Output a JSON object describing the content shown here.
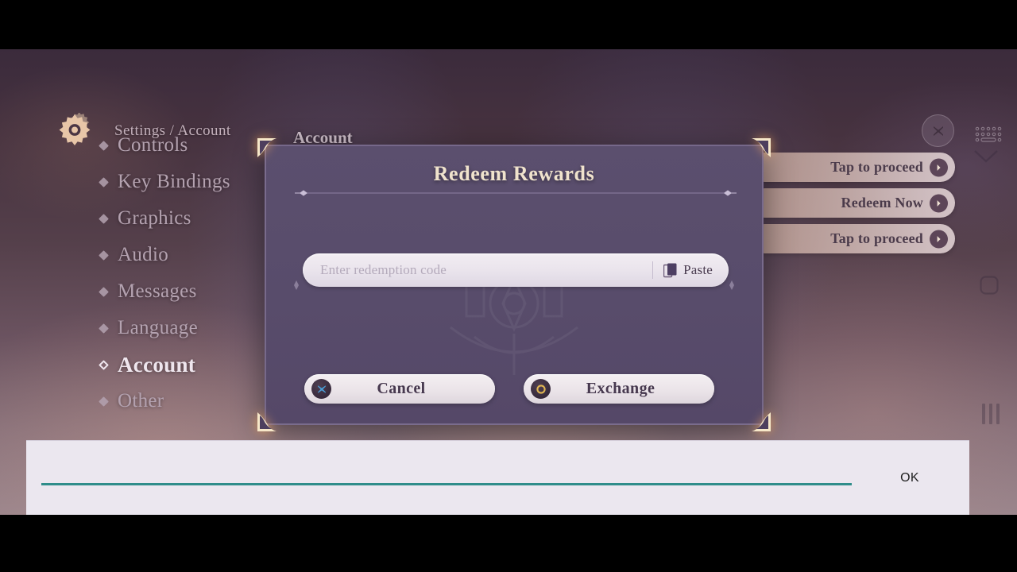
{
  "header": {
    "breadcrumb": "Settings / Account",
    "gear_icon": "gear-icon",
    "close_icon": "close-icon",
    "keyboard_icon": "keyboard-icon"
  },
  "sidebar": {
    "items": [
      {
        "label": "Controls",
        "active": false
      },
      {
        "label": "Key Bindings",
        "active": false
      },
      {
        "label": "Graphics",
        "active": false
      },
      {
        "label": "Audio",
        "active": false
      },
      {
        "label": "Messages",
        "active": false
      },
      {
        "label": "Language",
        "active": false
      },
      {
        "label": "Account",
        "active": true
      },
      {
        "label": "Other",
        "active": false
      }
    ]
  },
  "panel": {
    "title": "Account",
    "actions": [
      {
        "label": "Tap to proceed",
        "icon": "chevron-right-icon"
      },
      {
        "label": "Redeem Now",
        "icon": "chevron-right-icon"
      },
      {
        "label": "Tap to proceed",
        "icon": "chevron-right-icon"
      }
    ]
  },
  "dialog": {
    "title": "Redeem Rewards",
    "input": {
      "value": "",
      "placeholder": "Enter redemption code"
    },
    "paste": {
      "label": "Paste",
      "icon": "clipboard-icon"
    },
    "buttons": {
      "cancel": {
        "label": "Cancel",
        "icon": "cross-icon"
      },
      "exchange": {
        "label": "Exchange",
        "icon": "ring-icon"
      }
    }
  },
  "ime": {
    "value": "",
    "placeholder": "",
    "ok_label": "OK",
    "underline_color": "#2f8d8a"
  },
  "nav_glyphs": {
    "collapse": "chevron-down-icon",
    "home": "square-icon",
    "recents": "bars-icon"
  },
  "colors": {
    "dialog_bg": "#584c6b",
    "dialog_title": "#f0e3cd",
    "corner_gold": "#f4e2bd",
    "accent_blue": "#4a9fd8",
    "accent_gold": "#e0b552",
    "panel_button": "#e3beA8"
  }
}
